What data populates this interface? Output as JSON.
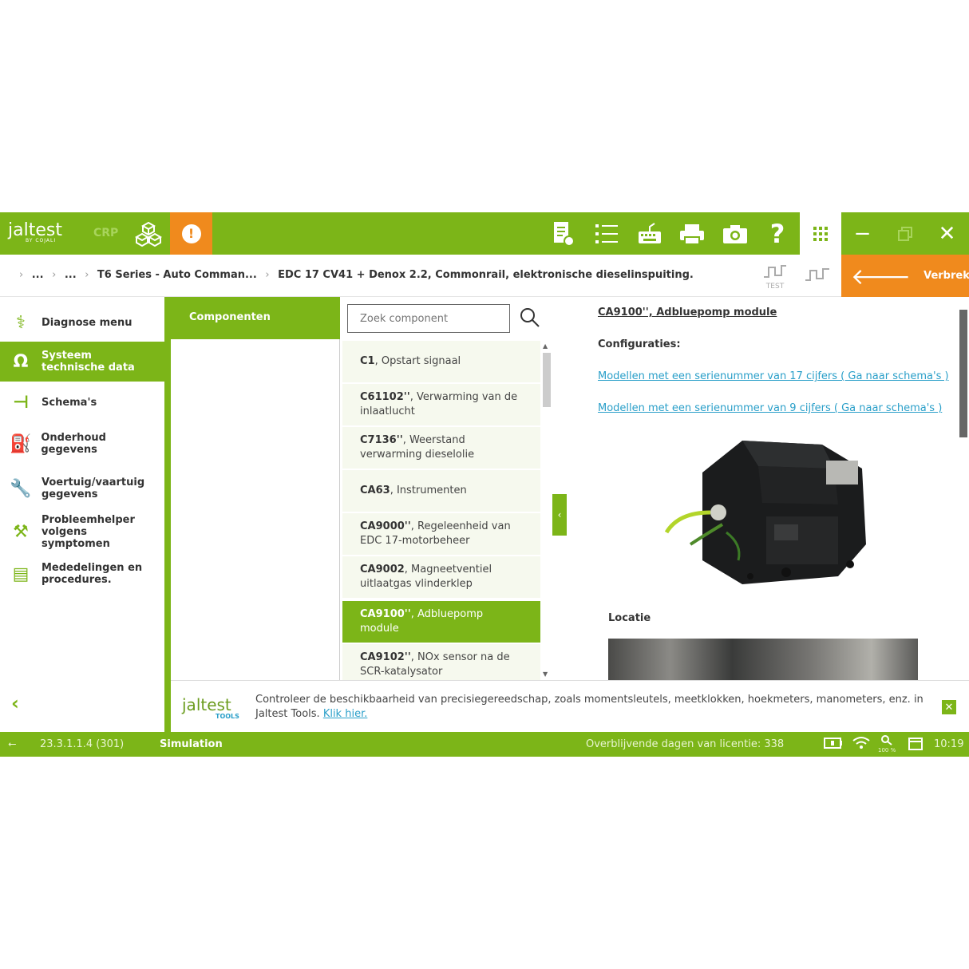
{
  "topbar": {
    "logo": "jaltest",
    "logo_sub": "BY COJALI",
    "crp_label": "CRP",
    "icons": [
      "systems-icon",
      "alert-icon",
      "report-icon",
      "list-icon",
      "keyboard-icon",
      "printer-icon",
      "camera-icon",
      "help-icon",
      "apps-grid-icon",
      "minimize-icon",
      "restore-icon",
      "close-icon"
    ],
    "alert_glyph": "!",
    "help_glyph": "?",
    "minimize_glyph": "−",
    "close_glyph": "✕"
  },
  "breadcrumb": {
    "items": [
      "...",
      "...",
      "T6 Series - Auto Comman...",
      "EDC 17 CV41 + Denox 2.2, Commonrail, elektronische dieselinspuiting."
    ],
    "test_label": "TEST",
    "disconnect_label": "Verbreken"
  },
  "sidebar": {
    "items": [
      {
        "label": "Diagnose menu",
        "icon": "diagnosis-icon"
      },
      {
        "label": "Systeem technische data",
        "icon": "omega-icon",
        "active": true
      },
      {
        "label": "Schema's",
        "icon": "schematic-icon"
      },
      {
        "label": "Onderhoud gegevens",
        "icon": "oil-can-icon"
      },
      {
        "label": "Voertuig/vaartuig gegevens",
        "icon": "wrench-icon"
      },
      {
        "label": "Probleemhelper volgens symptomen",
        "icon": "tools-icon"
      },
      {
        "label": "Mededelingen en procedures.",
        "icon": "document-icon"
      }
    ]
  },
  "components": {
    "header": "Componenten",
    "search_placeholder": "Zoek component",
    "items": [
      {
        "code": "C1",
        "name": ", Opstart signaal"
      },
      {
        "code": "C61102''",
        "name": ", Verwarming van de inlaatlucht"
      },
      {
        "code": "C7136''",
        "name": ", Weerstand verwarming dieselolie"
      },
      {
        "code": "CA63",
        "name": ", Instrumenten"
      },
      {
        "code": "CA9000''",
        "name": ", Regeleenheid van EDC 17-motorbeheer"
      },
      {
        "code": "CA9002",
        "name": ", Magneetventiel uitlaatgas vlinderklep"
      },
      {
        "code": "CA9100''",
        "name": ", Adbluepomp module",
        "selected": true
      },
      {
        "code": "CA9102''",
        "name": ", NOx sensor na de SCR-katalysator"
      }
    ]
  },
  "detail": {
    "title": "CA9100'', Adbluepomp module",
    "config_label": "Configuraties:",
    "links": [
      "Modellen met een serienummer van 17 cijfers ( Ga naar schema's )",
      "Modellen met een serienummer van 9 cijfers ( Ga naar schema's )"
    ],
    "location_label": "Locatie"
  },
  "notification": {
    "logo": "jaltest",
    "logo_sub": "TOOLS",
    "text": "Controleer de beschikbaarheid van precisiegereedschap, zoals momentsleutels, meetklokken, hoekmeters, manometers, enz. in Jaltest Tools. ",
    "link": "Klik hier."
  },
  "status": {
    "version": "23.3.1.1.4 (301)",
    "mode": "Simulation",
    "license": "Overblijvende dagen van licentie: 338",
    "zoom": "100 %",
    "time": "10:19"
  },
  "colors": {
    "brand_green": "#7cb518",
    "accent_orange": "#f08a1d",
    "link_blue": "#2a9fc9"
  }
}
